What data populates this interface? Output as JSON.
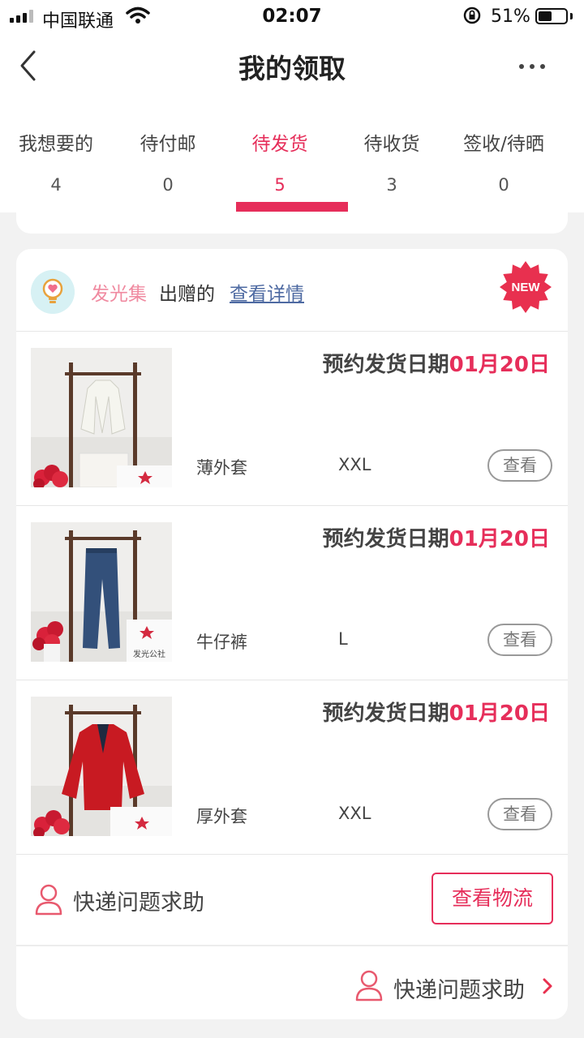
{
  "status_bar": {
    "carrier": "中国联通",
    "time": "02:07",
    "battery_percent": "51%",
    "battery_level": 0.51
  },
  "nav": {
    "title": "我的领取",
    "back_icon": "chevron-left-icon",
    "more_icon": "more-dots-icon"
  },
  "tabs": [
    {
      "label": "我想要的",
      "count": "4",
      "active": false
    },
    {
      "label": "待付邮",
      "count": "0",
      "active": false
    },
    {
      "label": "待发货",
      "count": "5",
      "active": true
    },
    {
      "label": "待收货",
      "count": "3",
      "active": false
    },
    {
      "label": "签收/待晒",
      "count": "0",
      "active": false
    }
  ],
  "card": {
    "brand": "发光集",
    "gift_text": "出赠的",
    "detail_link": "查看详情",
    "badge": "NEW",
    "items": [
      {
        "ship_label": "预约发货日期",
        "ship_date": "01月20日",
        "name": "薄外套",
        "size": "XXL",
        "view_label": "查看",
        "garment": "white-jacket",
        "watermark": ""
      },
      {
        "ship_label": "预约发货日期",
        "ship_date": "01月20日",
        "name": "牛仔裤",
        "size": "L",
        "view_label": "查看",
        "garment": "jeans",
        "watermark": "发光公社"
      },
      {
        "ship_label": "预约发货日期",
        "ship_date": "01月20日",
        "name": "厚外套",
        "size": "XXL",
        "view_label": "查看",
        "garment": "red-coat",
        "watermark": ""
      }
    ],
    "help_label": "快递问题求助",
    "track_label": "查看物流",
    "footer_help_label": "快递问题求助"
  },
  "colors": {
    "accent": "#e62e5a",
    "link": "#4e6aa2",
    "brand_pink": "#f08aa0"
  }
}
